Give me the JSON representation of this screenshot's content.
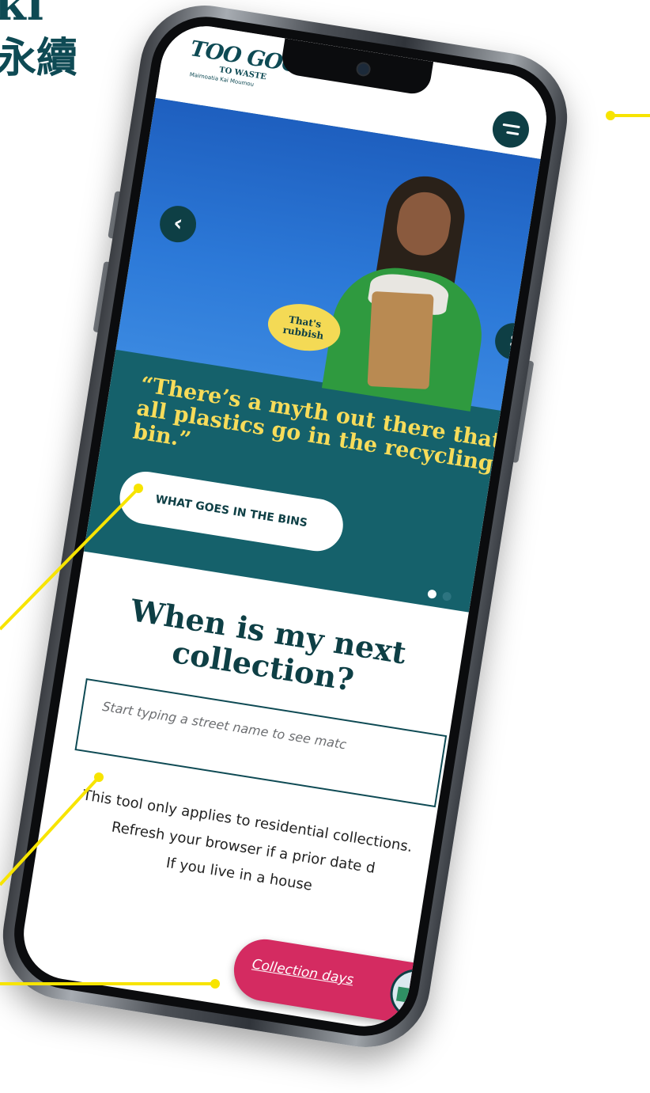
{
  "brand": {
    "line1": "ki",
    "line2": "永續"
  },
  "app": {
    "logo": {
      "title": "TOO GOOD",
      "subtitle": "TO WASTE",
      "tagline": "Maimoatia Kai Moumou"
    }
  },
  "hero": {
    "speech_bubble": "That's rubbish",
    "quote": "“There’s a myth out there that all plastics go in the recycling bin.”",
    "cta_label": "WHAT GOES IN THE BINS",
    "prev_icon": "chevron-left-icon",
    "next_icon": "chevron-right-icon",
    "slides_total": 2,
    "slide_active": 1
  },
  "collection": {
    "title": "When is my next collection?",
    "search_placeholder": "Start typing a street name to see matc",
    "info_text": "This tool only applies to residential collections. Refresh your browser if a prior date d",
    "info_text_2": "If you live in a house"
  },
  "fab": {
    "label": "Collection days",
    "icon": "rubbish-truck-icon"
  },
  "colors": {
    "brand_teal": "#0e4a54",
    "hero_teal": "#15616b",
    "sky_blue": "#2c79d8",
    "quote_yellow": "#f7dc5a",
    "fab_pink": "#d42b61",
    "callout_yellow": "#f7e400"
  }
}
